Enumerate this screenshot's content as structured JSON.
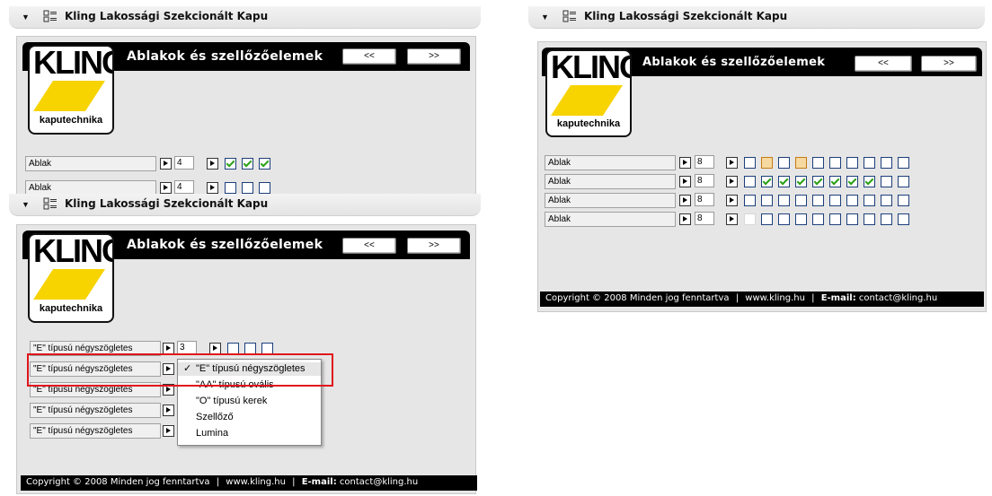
{
  "window_title": "Kling Lakossági Szekcionált Kapu",
  "section_heading": "Ablakok és szellőzőelemek",
  "nav": {
    "prev": "<<",
    "next": ">>"
  },
  "logo": {
    "brand": "KLING",
    "sub": "kaputechnika"
  },
  "footer": {
    "copyright": "Copyright © 2008 Minden jog fenntartva",
    "sep": "|",
    "site": "www.kling.hu",
    "email_label": "E-mail:",
    "email": "contact@kling.hu"
  },
  "panel_a": {
    "rows": [
      {
        "label": "Ablak",
        "qty": "4",
        "checks": [
          "checked",
          "checked",
          "checked"
        ]
      },
      {
        "label": "Ablak",
        "qty": "4",
        "checks": [
          "empty",
          "empty",
          "empty"
        ]
      }
    ]
  },
  "panel_b": {
    "rows": [
      {
        "label": "\"E\" típusú négyszögletes",
        "qty": "3",
        "checks": [
          "empty",
          "empty",
          "empty"
        ]
      },
      {
        "label": "\"E\" típusú négyszögletes"
      },
      {
        "label": "\"E\" típusú négyszögletes"
      },
      {
        "label": "\"E\" típusú négyszögletes"
      },
      {
        "label": "\"E\" típusú négyszögletes"
      }
    ],
    "dropdown": {
      "options": [
        "\"E\" típusú négyszögletes",
        "\"AA\" típusú ovális",
        "\"O\" típusú kerek",
        "Szellőző",
        "Lumina"
      ],
      "selected": 0,
      "check_glyph": "✓"
    }
  },
  "panel_c": {
    "rows": [
      {
        "label": "Ablak",
        "qty": "8",
        "checks": [
          "empty",
          "orange",
          "empty",
          "orange",
          "empty",
          "empty",
          "empty",
          "empty",
          "empty",
          "empty"
        ]
      },
      {
        "label": "Ablak",
        "qty": "8",
        "checks": [
          "empty",
          "checked",
          "checked",
          "checked",
          "checked",
          "checked",
          "checked",
          "checked",
          "empty",
          "empty"
        ]
      },
      {
        "label": "Ablak",
        "qty": "8",
        "checks": [
          "empty",
          "empty",
          "empty",
          "empty",
          "empty",
          "empty",
          "empty",
          "empty",
          "empty",
          "empty"
        ]
      },
      {
        "label": "Ablak",
        "qty": "8",
        "checks": [
          "plain",
          "empty",
          "empty",
          "empty",
          "empty",
          "empty",
          "empty",
          "empty",
          "empty",
          "empty"
        ]
      }
    ]
  },
  "colors": {
    "highlight_box": "#e0141b",
    "logo_yellow": "#f7d300",
    "check_green": "#2aa015"
  }
}
